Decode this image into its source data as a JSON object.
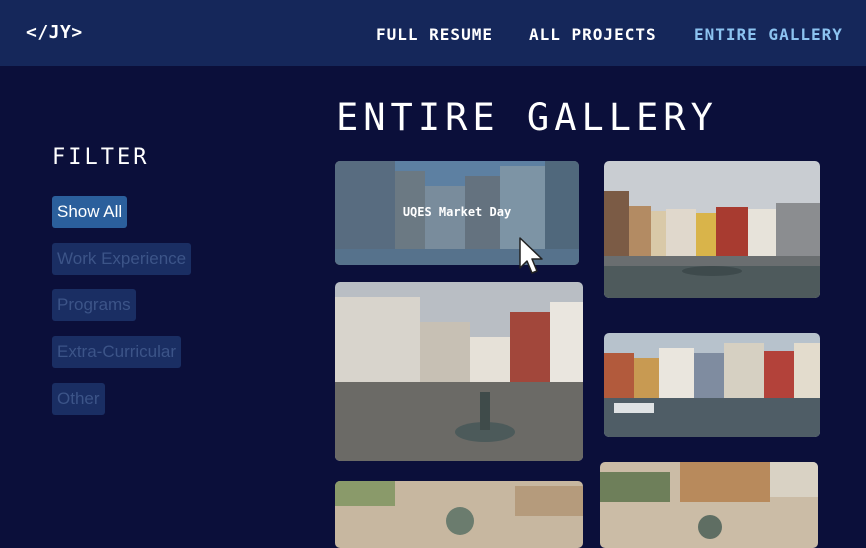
{
  "nav": {
    "logo": "</JY>",
    "links": [
      {
        "label": "FULL RESUME",
        "active": false
      },
      {
        "label": "ALL PROJECTS",
        "active": false
      },
      {
        "label": "ENTIRE GALLERY",
        "active": true
      }
    ]
  },
  "page": {
    "title": "ENTIRE GALLERY"
  },
  "filter": {
    "title": "FILTER",
    "options": [
      {
        "label": "Show All",
        "active": true
      },
      {
        "label": "Work Experience",
        "active": false
      },
      {
        "label": "Programs",
        "active": false
      },
      {
        "label": "Extra-Curricular",
        "active": false
      },
      {
        "label": "Other",
        "active": false
      }
    ]
  },
  "gallery": {
    "hovered_caption": "UQES Market Day"
  },
  "colors": {
    "background": "#0b0f3a",
    "navbar": "#15275a",
    "active_link": "#8cc3f0",
    "active_filter": "#2b5f9c",
    "inactive_filter": "#1a2e63"
  }
}
